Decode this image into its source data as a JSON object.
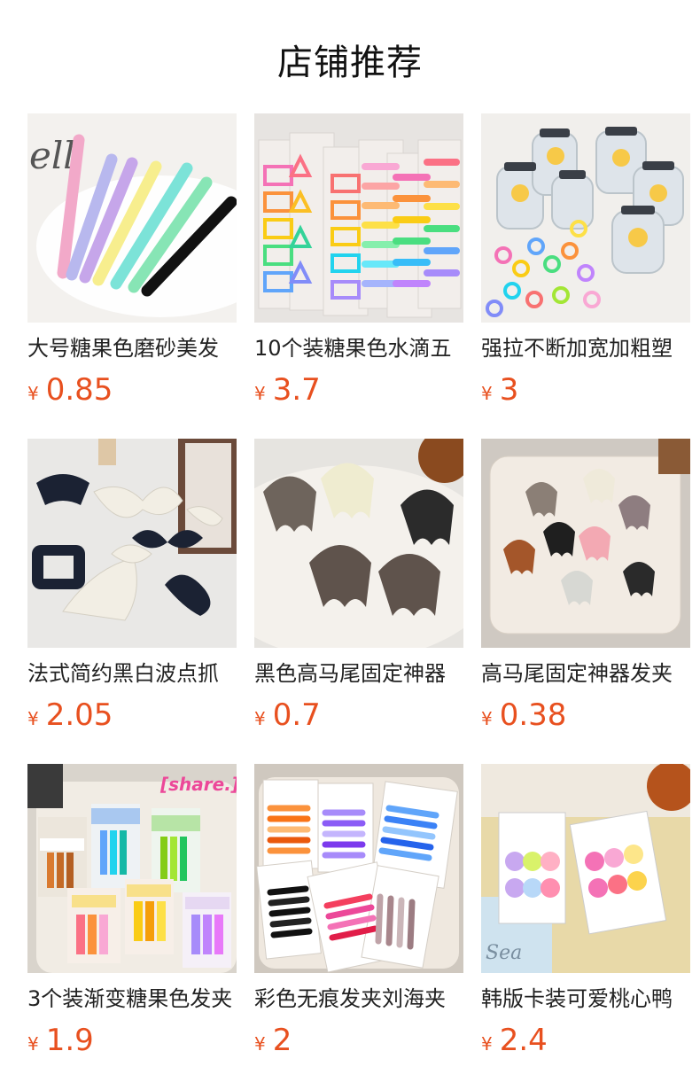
{
  "header": {
    "title": "店铺推荐"
  },
  "currency": "¥",
  "products": [
    {
      "name": "大号糖果色磨砂美发",
      "price": "0.85",
      "image": "pastel-duckbill-clips-photo"
    },
    {
      "name": "10个装糖果色水滴五",
      "price": "3.7",
      "image": "colorful-snap-clips-cards-photo"
    },
    {
      "name": "强拉不断加宽加粗塑",
      "price": "3",
      "image": "hair-tie-jars-photo"
    },
    {
      "name": "法式简约黑白波点抓",
      "price": "2.05",
      "image": "polka-dot-claw-clips-photo"
    },
    {
      "name": "黑色高马尾固定神器",
      "price": "0.7",
      "image": "matte-claw-clips-photo"
    },
    {
      "name": "高马尾固定神器发夹",
      "price": "0.38",
      "image": "mini-claw-clips-tray-photo"
    },
    {
      "name": "3个装渐变糖果色发夹",
      "price": "1.9",
      "image": "gradient-clips-bags-photo"
    },
    {
      "name": "彩色无痕发夹刘海夹",
      "price": "2",
      "image": "no-crease-clips-cards-photo"
    },
    {
      "name": "韩版卡装可爱桃心鸭",
      "price": "2.4",
      "image": "heart-clips-cards-photo"
    }
  ]
}
